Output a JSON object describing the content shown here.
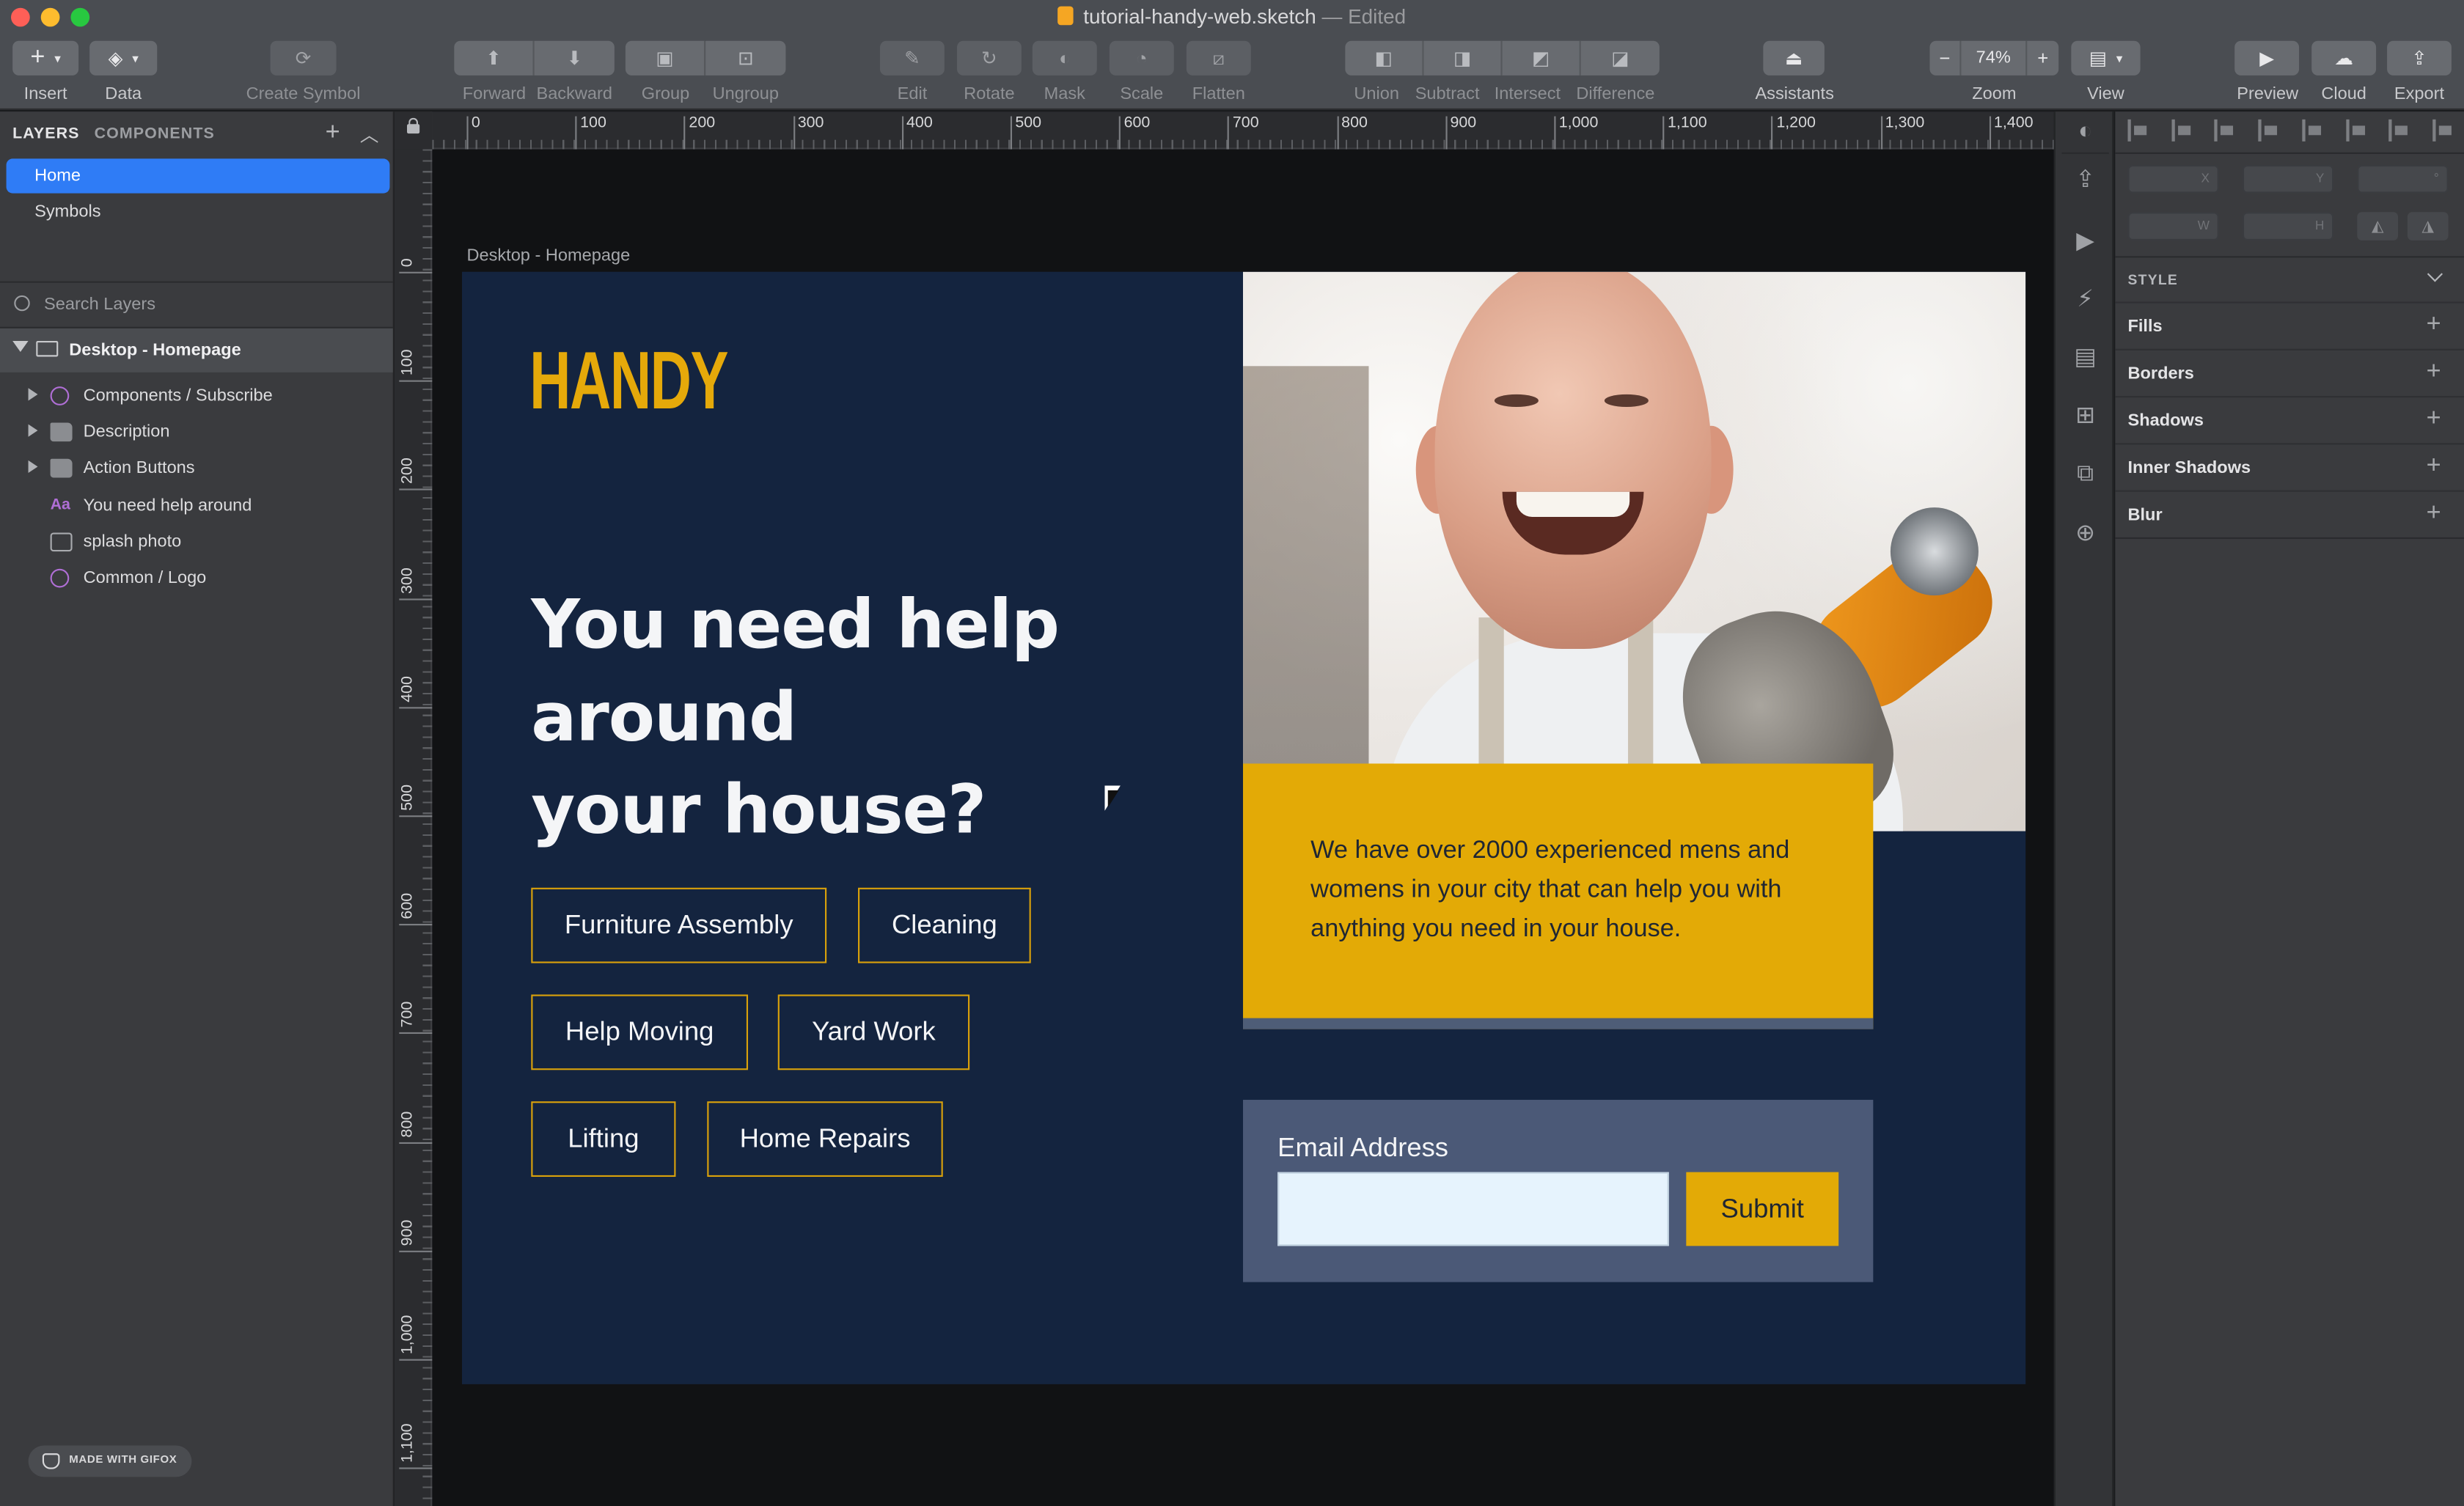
{
  "window": {
    "document_name": "tutorial-handy-web.sketch",
    "status": "— Edited"
  },
  "toolbar": {
    "insert": "Insert",
    "data": "Data",
    "create_symbol": "Create Symbol",
    "forward": "Forward",
    "backward": "Backward",
    "group": "Group",
    "ungroup": "Ungroup",
    "edit": "Edit",
    "rotate": "Rotate",
    "mask": "Mask",
    "scale": "Scale",
    "flatten": "Flatten",
    "union": "Union",
    "subtract": "Subtract",
    "intersect": "Intersect",
    "difference": "Difference",
    "assistants": "Assistants",
    "zoom_value": "74%",
    "zoom": "Zoom",
    "view": "View",
    "preview": "Preview",
    "cloud": "Cloud",
    "export": "Export",
    "zoom_minus": "−",
    "zoom_plus": "+",
    "plus_glyph": "+"
  },
  "left_panel": {
    "tabs": {
      "layers": "LAYERS",
      "components": "COMPONENTS"
    },
    "pages": [
      "Home",
      "Symbols"
    ],
    "search_placeholder": "Search Layers",
    "artboard_name": "Desktop - Homepage",
    "layers": [
      {
        "label": "Components / Subscribe",
        "icon": "symbol-icon"
      },
      {
        "label": "Description",
        "icon": "folder-icon"
      },
      {
        "label": "Action Buttons",
        "icon": "folder-icon"
      },
      {
        "label": "You need help around",
        "icon": "text-icon",
        "icon_glyph": "Aa"
      },
      {
        "label": "splash photo",
        "icon": "image-icon"
      },
      {
        "label": "Common / Logo",
        "icon": "symbol-icon"
      }
    ],
    "watermark": "MADE WITH GIFOX"
  },
  "canvas": {
    "ruler_x": [
      "0",
      "100",
      "200",
      "300",
      "400",
      "500",
      "600",
      "700",
      "800",
      "900",
      "1,000",
      "1,100",
      "1,200",
      "1,300",
      "1,400"
    ],
    "ruler_y": [
      "0",
      "100",
      "200",
      "300",
      "400",
      "500",
      "600",
      "700",
      "800",
      "900",
      "1,000",
      "1,100"
    ],
    "artboard_title": "Desktop - Homepage"
  },
  "design": {
    "logo": "HANDY",
    "headline_lines": [
      "You need help",
      "around",
      "your house?"
    ],
    "services": [
      "Furniture Assembly",
      "Cleaning",
      "Help Moving",
      "Yard Work",
      "Lifting",
      "Home Repairs"
    ],
    "description": "We have over 2000 experienced mens and womens in your city that can help you with anything you need in your house.",
    "email_label": "Email Address",
    "email_value": "",
    "submit": "Submit",
    "colors": {
      "navy": "#14243f",
      "gold": "#e3aa06",
      "slate": "#4b5977",
      "input": "#e6f3fd"
    }
  },
  "inspector": {
    "units": {
      "x": "X",
      "y": "Y",
      "rotate": "°",
      "w": "W",
      "h": "H"
    },
    "style_heading": "STYLE",
    "sections": [
      "Fills",
      "Borders",
      "Shadows",
      "Inner Shadows",
      "Blur"
    ]
  }
}
